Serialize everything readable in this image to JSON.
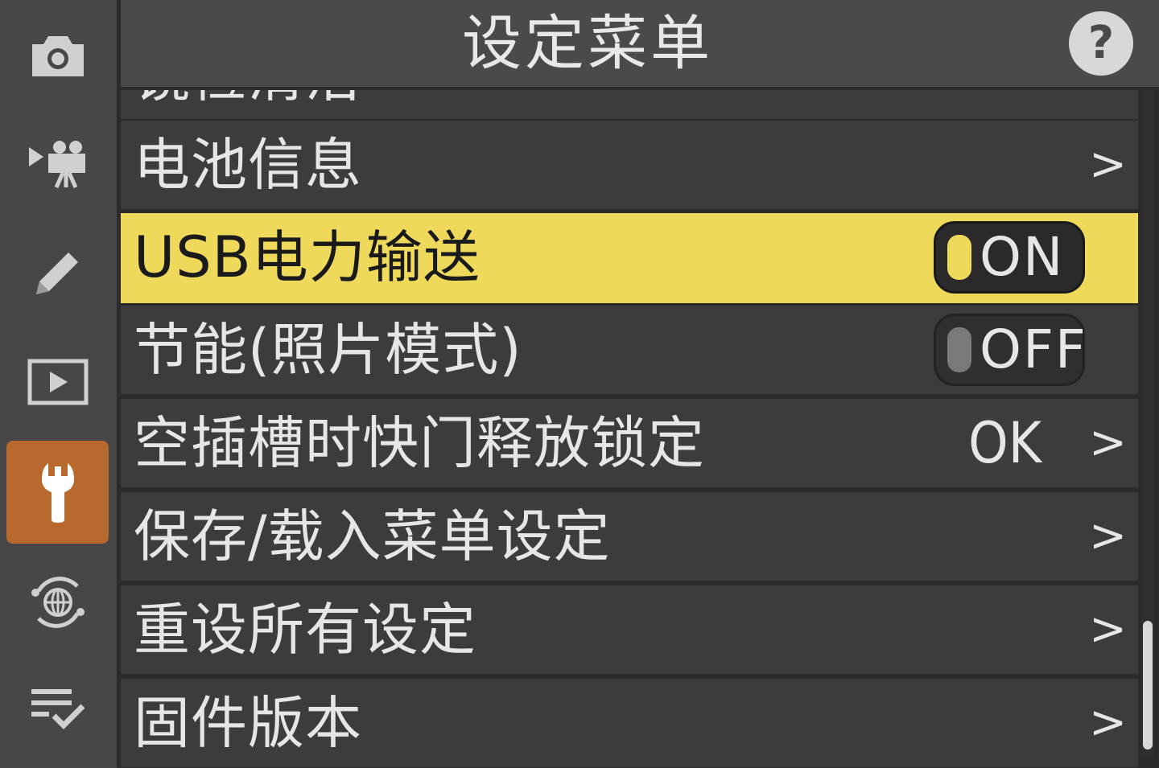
{
  "header": {
    "title": "设定菜单",
    "help_label": "?"
  },
  "sidebar": {
    "items": [
      {
        "icon": "camera-icon"
      },
      {
        "icon": "movie-camera-icon"
      },
      {
        "icon": "pencil-icon"
      },
      {
        "icon": "playback-icon"
      },
      {
        "icon": "wrench-icon",
        "active": true
      },
      {
        "icon": "network-globe-icon"
      },
      {
        "icon": "my-menu-icon"
      }
    ]
  },
  "menu": {
    "partial_label": "镜检清洁",
    "items": [
      {
        "label": "电池信息",
        "chevron": ">"
      },
      {
        "label": "USB电力输送",
        "toggle": "ON"
      },
      {
        "label": "节能(照片模式)",
        "toggle": "OFF"
      },
      {
        "label": "空插槽时快门释放锁定",
        "value": "OK",
        "chevron": ">"
      },
      {
        "label": "保存/载入菜单设定",
        "chevron": ">"
      },
      {
        "label": "重设所有设定",
        "chevron": ">"
      },
      {
        "label": "固件版本",
        "chevron": ">"
      }
    ]
  },
  "colors": {
    "highlight": "#efd95a",
    "active_tab": "#b86a2e"
  }
}
